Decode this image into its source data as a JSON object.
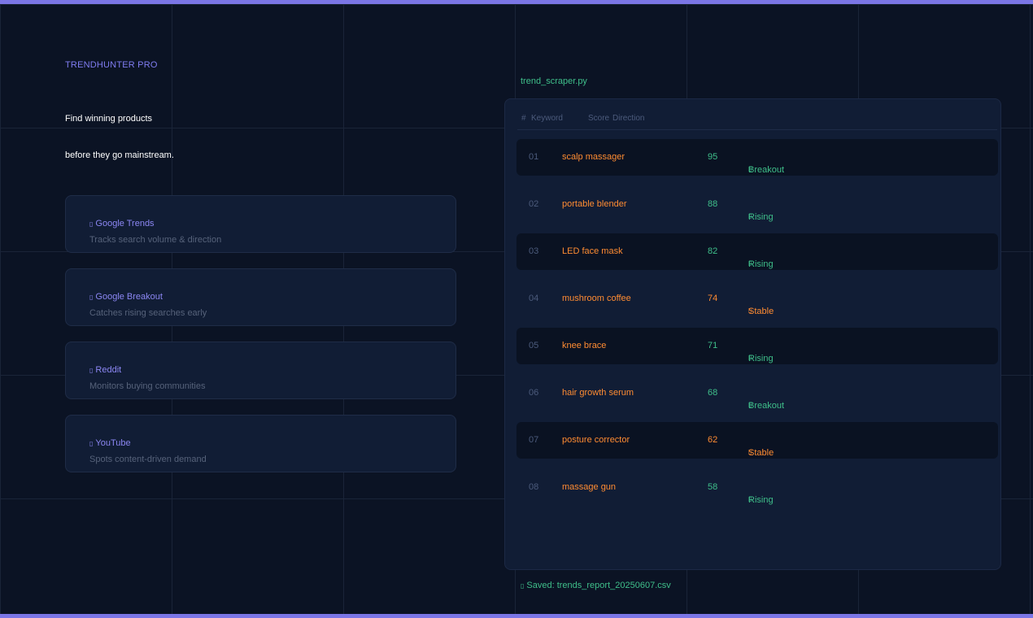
{
  "brand": "TRENDHUNTER PRO",
  "headline": {
    "line1": "Find winning products",
    "line2": "before they go mainstream."
  },
  "sources": [
    {
      "name": "Google Trends",
      "description": "Tracks search volume & direction",
      "icon": "trend-icon"
    },
    {
      "name": "Google Breakout",
      "description": "Catches rising searches early",
      "icon": "breakout-icon"
    },
    {
      "name": "Reddit",
      "description": "Monitors buying communities",
      "icon": "reddit-icon"
    },
    {
      "name": "YouTube",
      "description": "Spots content-driven demand",
      "icon": "youtube-icon"
    }
  ],
  "file_title": "trend_scraper.py",
  "table": {
    "headers": {
      "num": "#",
      "keyword": "Keyword",
      "score": "Score",
      "direction": "Direction"
    },
    "rows": [
      {
        "num": "01",
        "keyword": "scalp massager",
        "score": "95",
        "direction": "Breakout",
        "status": "green"
      },
      {
        "num": "02",
        "keyword": "portable blender",
        "score": "88",
        "direction": "Rising",
        "status": "green"
      },
      {
        "num": "03",
        "keyword": "LED face mask",
        "score": "82",
        "direction": "Rising",
        "status": "green"
      },
      {
        "num": "04",
        "keyword": "mushroom coffee",
        "score": "74",
        "direction": "Stable",
        "status": "orange"
      },
      {
        "num": "05",
        "keyword": "knee brace",
        "score": "71",
        "direction": "Rising",
        "status": "green"
      },
      {
        "num": "06",
        "keyword": "hair growth serum",
        "score": "68",
        "direction": "Breakout",
        "status": "green"
      },
      {
        "num": "07",
        "keyword": "posture corrector",
        "score": "62",
        "direction": "Stable",
        "status": "orange"
      },
      {
        "num": "08",
        "keyword": "massage gun",
        "score": "58",
        "direction": "Rising",
        "status": "green"
      }
    ]
  },
  "saved": "Saved: trends_report_20250607.csv",
  "colors": {
    "accent": "#7b76e6",
    "green": "#3fbf8a",
    "orange": "#ff8c32",
    "background": "#0b1324"
  }
}
